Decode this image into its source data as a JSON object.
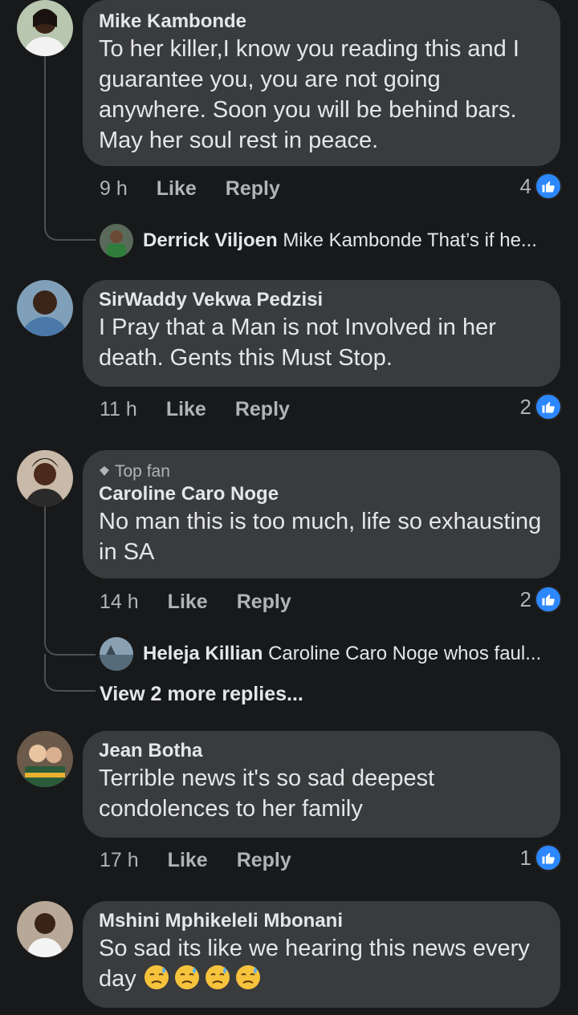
{
  "comments": [
    {
      "name": "Mike Kambonde",
      "text": "To her killer,I know you reading this and I guarantee you, you are not going anywhere. Soon you will be behind bars. May her soul rest in peace.",
      "time": "9 h",
      "like_label": "Like",
      "reply_label": "Reply",
      "reaction_count": "4",
      "reply_preview": {
        "name": "Derrick Viljoen",
        "text": "Mike Kambonde That’s if he..."
      }
    },
    {
      "name": "SirWaddy Vekwa Pedzisi",
      "text": "I Pray that a Man is not Involved in her death. Gents this Must Stop.",
      "time": "11 h",
      "like_label": "Like",
      "reply_label": "Reply",
      "reaction_count": "2"
    },
    {
      "badge": "Top fan",
      "name": "Caroline Caro Noge",
      "text": "No man this is too much, life so exhausting in SA",
      "time": "14 h",
      "like_label": "Like",
      "reply_label": "Reply",
      "reaction_count": "2",
      "reply_preview": {
        "name": "Heleja Killian",
        "text": "Caroline Caro Noge whos faul..."
      },
      "view_more": "View 2 more replies..."
    },
    {
      "name": "Jean Botha",
      "text": "Terrible news it's so sad deepest condolences to her family",
      "time": "17 h",
      "like_label": "Like",
      "reply_label": "Reply",
      "reaction_count": "1"
    },
    {
      "name": "Mshini Mphikeleli Mbonani",
      "text": "So sad its like we hearing this news every day",
      "emojis": [
        "downcast-sweat-emoji",
        "downcast-sweat-emoji",
        "downcast-sweat-emoji",
        "downcast-sweat-emoji"
      ]
    }
  ],
  "colors": {
    "background": "#18191a",
    "bubble": "#3a3b3c",
    "like_blue": "#2d88ff",
    "muted": "#b0b3b8"
  }
}
